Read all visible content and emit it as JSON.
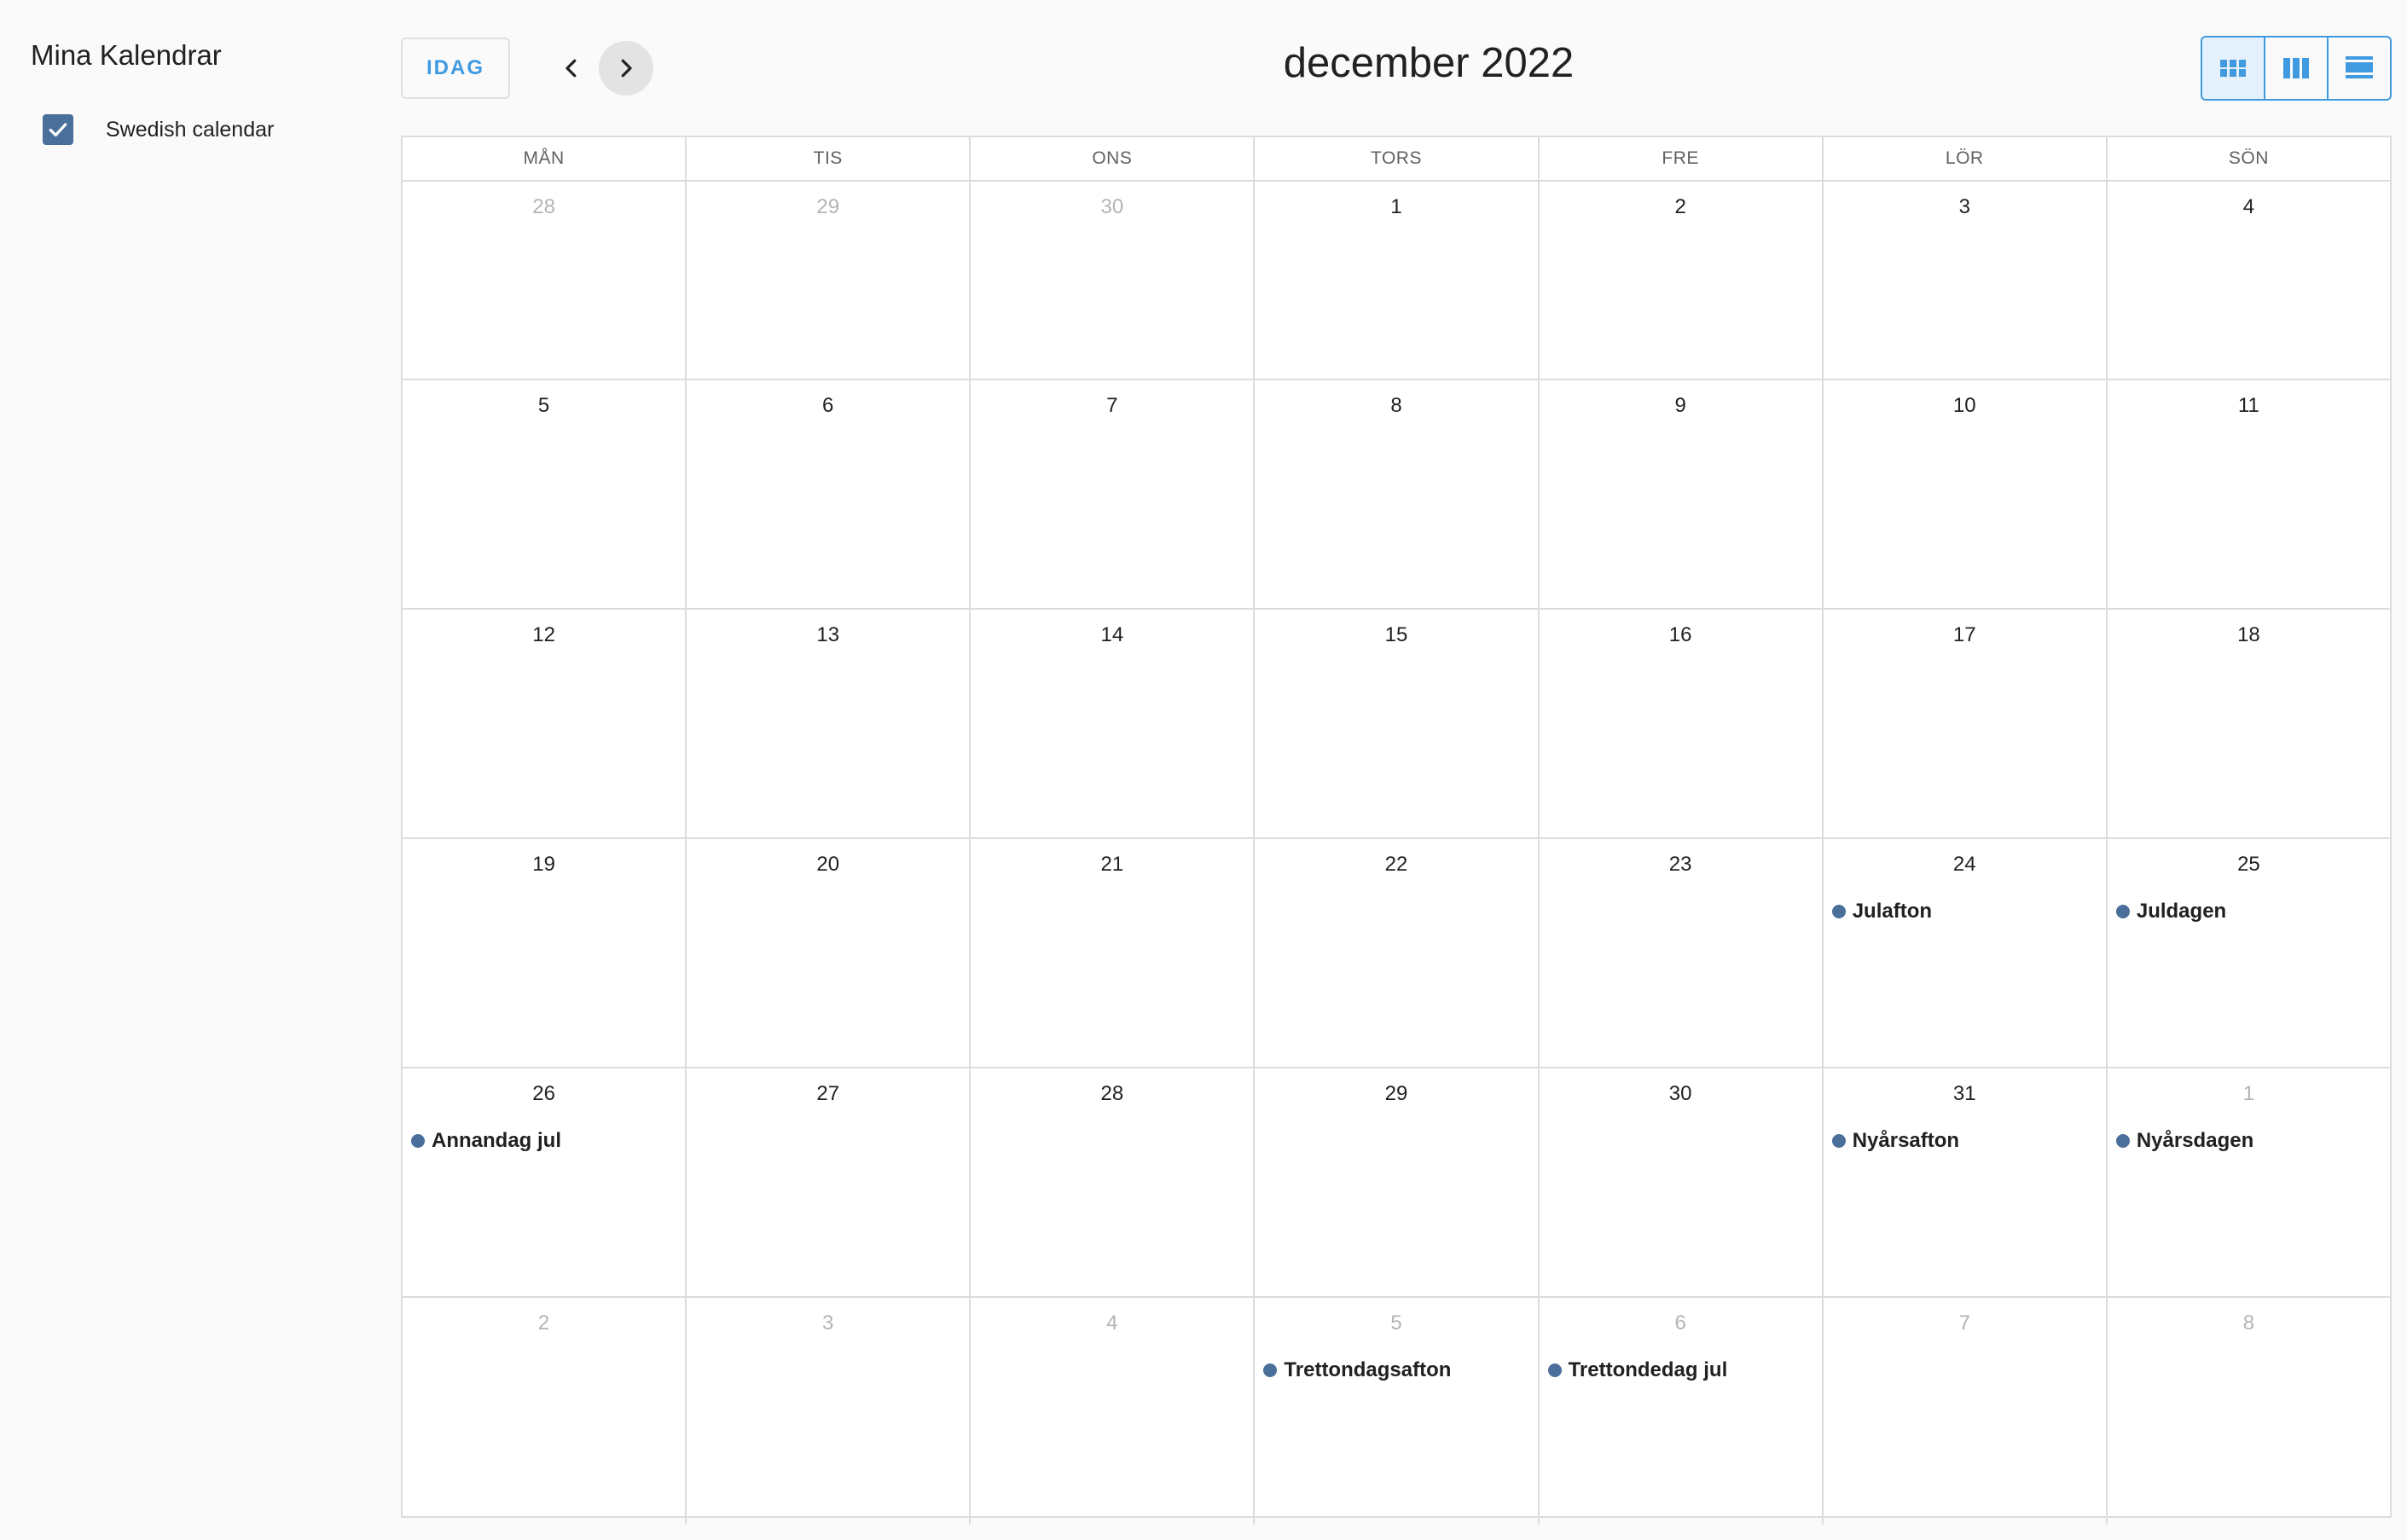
{
  "sidebar": {
    "title": "Mina Kalendrar",
    "calendars": [
      {
        "label": "Swedish calendar",
        "checked": true,
        "color": "#4a6f9b"
      }
    ]
  },
  "toolbar": {
    "today_label": "IDAG",
    "prev_icon": "chevron-left-icon",
    "next_icon": "chevron-right-icon",
    "month_title": "december 2022",
    "views": [
      {
        "name": "month",
        "icon": "grid-view-icon",
        "active": true
      },
      {
        "name": "week",
        "icon": "columns-view-icon",
        "active": false
      },
      {
        "name": "list",
        "icon": "list-view-icon",
        "active": false
      }
    ]
  },
  "colors": {
    "accent": "#3f9ae0",
    "event_dot": "#4a6f9b",
    "other_month_text": "#b4b4b4"
  },
  "calendar": {
    "weekdays": [
      "MÅN",
      "TIS",
      "ONS",
      "TORS",
      "FRE",
      "LÖR",
      "SÖN"
    ],
    "weeks": [
      [
        {
          "day": "28",
          "other": true
        },
        {
          "day": "29",
          "other": true
        },
        {
          "day": "30",
          "other": true
        },
        {
          "day": "1"
        },
        {
          "day": "2"
        },
        {
          "day": "3"
        },
        {
          "day": "4"
        }
      ],
      [
        {
          "day": "5"
        },
        {
          "day": "6"
        },
        {
          "day": "7"
        },
        {
          "day": "8"
        },
        {
          "day": "9"
        },
        {
          "day": "10"
        },
        {
          "day": "11"
        }
      ],
      [
        {
          "day": "12"
        },
        {
          "day": "13"
        },
        {
          "day": "14"
        },
        {
          "day": "15"
        },
        {
          "day": "16"
        },
        {
          "day": "17"
        },
        {
          "day": "18"
        }
      ],
      [
        {
          "day": "19"
        },
        {
          "day": "20"
        },
        {
          "day": "21"
        },
        {
          "day": "22"
        },
        {
          "day": "23"
        },
        {
          "day": "24",
          "event": "Julafton"
        },
        {
          "day": "25",
          "event": "Juldagen"
        }
      ],
      [
        {
          "day": "26",
          "event": "Annandag jul"
        },
        {
          "day": "27"
        },
        {
          "day": "28"
        },
        {
          "day": "29"
        },
        {
          "day": "30"
        },
        {
          "day": "31",
          "event": "Nyårsafton"
        },
        {
          "day": "1",
          "other": true,
          "event": "Nyårsdagen"
        }
      ],
      [
        {
          "day": "2",
          "other": true
        },
        {
          "day": "3",
          "other": true
        },
        {
          "day": "4",
          "other": true
        },
        {
          "day": "5",
          "other": true,
          "event": "Trettondagsafton"
        },
        {
          "day": "6",
          "other": true,
          "event": "Trettondedag jul"
        },
        {
          "day": "7",
          "other": true
        },
        {
          "day": "8",
          "other": true
        }
      ]
    ]
  }
}
